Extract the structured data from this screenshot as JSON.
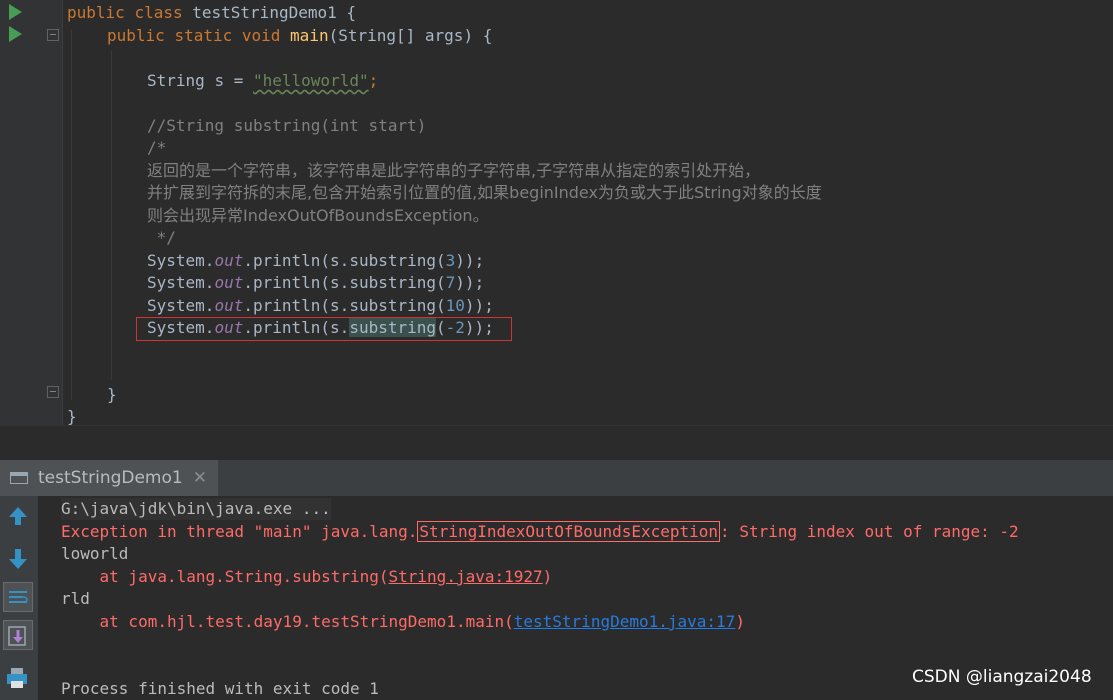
{
  "editor": {
    "lines": [
      {
        "id": "class-decl",
        "kw1": "public",
        "kw2": "class",
        "name": "testStringDemo1",
        "brace": "{"
      },
      {
        "id": "main-decl",
        "kw1": "public",
        "kw2": "static",
        "kw3": "void",
        "fn": "main",
        "params": "(String[] args)",
        "brace": "{"
      },
      {
        "id": "string-decl",
        "type": "String",
        "var": "s",
        "eq": "=",
        "str": "\"helloworld\"",
        "semi": ";"
      },
      {
        "id": "comment-sig",
        "text": "//String substring(int start)"
      },
      {
        "id": "comment-open",
        "text": "/*"
      },
      {
        "id": "comment-zh1",
        "text": "返回的是一个字符串，该字符串是此字符串的子字符串,子字符串从指定的索引处开始，"
      },
      {
        "id": "comment-zh2",
        "text": "并扩展到字符拆的末尾,包含开始索引位置的值,如果beginIndex为负或大于此String对象的长度"
      },
      {
        "id": "comment-zh3",
        "text": "则会出现异常IndexOutOfBoundsException。"
      },
      {
        "id": "comment-close",
        "text": " */"
      },
      {
        "id": "println-1",
        "sys": "System.",
        "out": "out",
        "mid": ".println(s.",
        "method": "substring",
        "arg": "3",
        "end": "));"
      },
      {
        "id": "println-2",
        "sys": "System.",
        "out": "out",
        "mid": ".println(s.",
        "method": "substring",
        "arg": "7",
        "end": "));"
      },
      {
        "id": "println-3",
        "sys": "System.",
        "out": "out",
        "mid": ".println(s.",
        "method": "substring",
        "arg": "10",
        "end": "));"
      },
      {
        "id": "println-4",
        "sys": "System.",
        "out": "out",
        "mid": ".println(s.",
        "method": "substring",
        "arg": "-2",
        "end": "));"
      },
      {
        "id": "close-main",
        "text": "}"
      },
      {
        "id": "close-class",
        "text": "}"
      }
    ]
  },
  "run_panel": {
    "tab_label": "testStringDemo1",
    "close_glyph": "✕"
  },
  "console": {
    "cmd": "G:\\java\\jdk\\bin\\java.exe ...",
    "err_prefix": "Exception in thread ",
    "err_thread": "\"main\"",
    "err_pkg": " java.lang.",
    "err_exc": "StringIndexOutOfBoundsException",
    "err_msg": ": String index out of range: -2",
    "out1": "loworld",
    "trace1_prefix": "    at java.lang.String.substring(",
    "trace1_link": "String.java:1927",
    "trace1_suffix": ")",
    "out2": "rld",
    "trace2_prefix": "    at com.hjl.test.day19.testStringDemo1.main(",
    "trace2_link": "testStringDemo1.java:17",
    "trace2_suffix": ")",
    "finish": "Process finished with exit code 1"
  },
  "watermark": "CSDN @liangzai2048",
  "colors": {
    "keyword": "#cc7832",
    "function": "#ffc66d",
    "string": "#6a8759",
    "comment": "#808080",
    "field": "#9876aa",
    "number": "#6897bb",
    "error": "#ff6b68",
    "link": "#287bde",
    "highlight_box": "#d03535"
  },
  "icons": [
    "run-gutter-icon",
    "fold-icon",
    "console-tab-icon",
    "close-icon",
    "scroll-up-icon",
    "scroll-down-icon",
    "soft-wrap-icon",
    "scroll-to-end-icon",
    "print-icon"
  ]
}
